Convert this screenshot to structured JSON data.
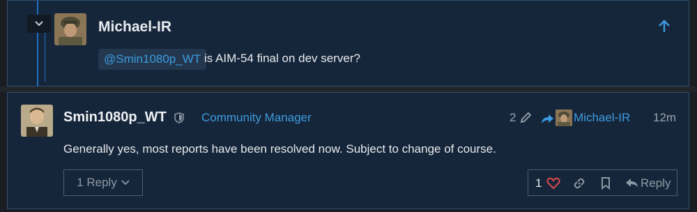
{
  "quoted_post": {
    "username": "Michael-IR",
    "mention": "@Smin1080p_WT",
    "text": "is AIM-54 final on dev server?"
  },
  "post": {
    "username": "Smin1080p_WT",
    "role": "Community Manager",
    "edit_count": "2",
    "reply_to_username": "Michael-IR",
    "time": "12m",
    "body": "Generally yes, most reports have been resolved now. Subject to change of course.",
    "replies_button_label": "1 Reply",
    "like_count": "1",
    "reply_label": "Reply"
  },
  "colors": {
    "accent": "#3d9be0",
    "card_bg": "#16263a",
    "like_heart": "#e0474c"
  },
  "icons": {
    "collapse": "chevron-down-icon",
    "scroll_up": "arrow-up-icon",
    "moderator": "shield-icon",
    "edited": "pencil-icon",
    "reply_to": "share-arrow-icon",
    "like": "heart-icon",
    "link": "link-icon",
    "bookmark": "bookmark-icon",
    "reply": "reply-icon"
  }
}
